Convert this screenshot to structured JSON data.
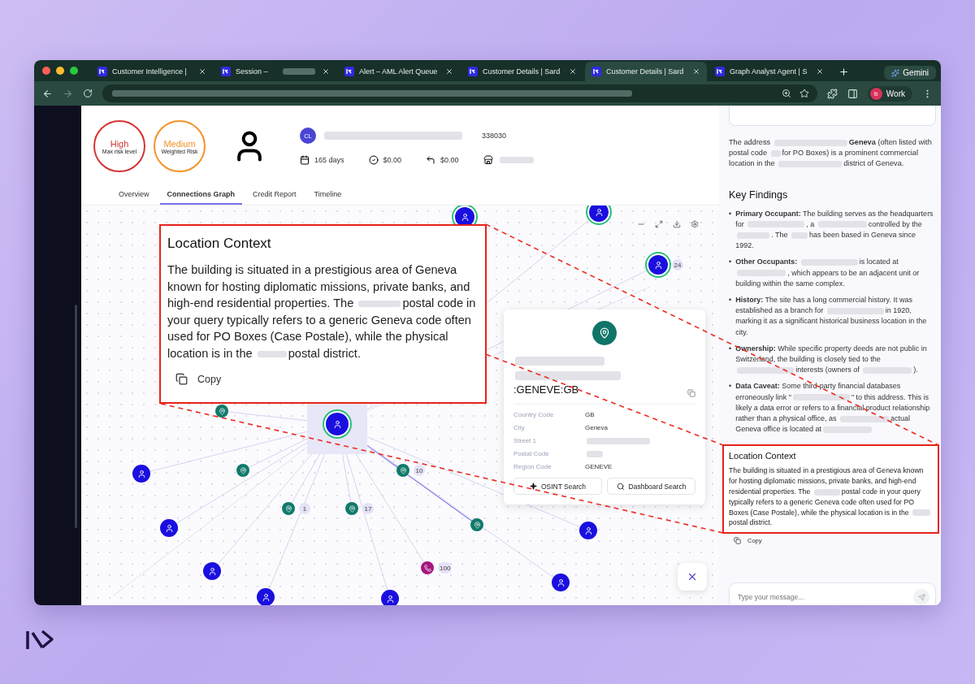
{
  "browser": {
    "tabs": [
      {
        "title": "Customer Intelligence | ",
        "selected": false
      },
      {
        "title": "Session – ",
        "selected": false
      },
      {
        "title": "Alert – AML Alert Queue",
        "selected": false
      },
      {
        "title": "Customer Details | Sard",
        "selected": false
      },
      {
        "title": "Customer Details | Sard",
        "selected": true
      },
      {
        "title": "Graph Analyst Agent | S",
        "selected": false
      }
    ],
    "assistant": "Gemini",
    "profile": {
      "initial": "b",
      "label": "Work"
    }
  },
  "header": {
    "risks": [
      {
        "level": "High",
        "caption": "Max risk level",
        "color": "#d63333"
      },
      {
        "level": "Medium",
        "caption": "Weighted Risk",
        "color": "#f5922a"
      }
    ],
    "initials": "CL",
    "customer_id": "338030",
    "stats": [
      {
        "kind": "calendar",
        "value": "165 days"
      },
      {
        "kind": "check",
        "value": "$0.00"
      },
      {
        "kind": "return",
        "value": "$0.00"
      },
      {
        "kind": "store"
      }
    ]
  },
  "page_tabs": [
    {
      "label": "Overview",
      "selected": false
    },
    {
      "label": "Connections Graph",
      "selected": true
    },
    {
      "label": "Credit Report",
      "selected": false
    },
    {
      "label": "Timeline",
      "selected": false
    }
  ],
  "graph": {
    "nodes": [
      {
        "kind": "person",
        "ring": true,
        "selected": false
      },
      {
        "kind": "person",
        "ring": true,
        "selected": false
      },
      {
        "kind": "person",
        "ring": true,
        "selected": false,
        "badge": "24"
      },
      {
        "kind": "person",
        "ring": true,
        "selected": true
      },
      {
        "kind": "location",
        "ring": false,
        "selected": false
      },
      {
        "kind": "location",
        "ring": false,
        "selected": false
      },
      {
        "kind": "location",
        "ring": false,
        "selected": false,
        "badge": "10"
      },
      {
        "kind": "location",
        "ring": false,
        "selected": false,
        "badge": "1"
      },
      {
        "kind": "location",
        "ring": false,
        "selected": false,
        "badge": "17"
      },
      {
        "kind": "location",
        "ring": false,
        "selected": false
      },
      {
        "kind": "phone",
        "ring": false,
        "selected": false,
        "badge": "100"
      },
      {
        "kind": "person",
        "ring": false,
        "selected": false
      },
      {
        "kind": "person",
        "ring": false,
        "selected": false
      },
      {
        "kind": "person",
        "ring": false,
        "selected": false
      },
      {
        "kind": "person",
        "ring": false,
        "selected": false
      },
      {
        "kind": "person",
        "ring": false,
        "selected": false
      },
      {
        "kind": "person",
        "ring": false,
        "selected": false
      },
      {
        "kind": "person",
        "ring": false,
        "selected": false
      }
    ]
  },
  "detail_card": {
    "title_end": ":GENEVE:GB",
    "fields": [
      {
        "label": "Country Code",
        "value": "GB"
      },
      {
        "label": "City",
        "value": "Geneva"
      },
      {
        "label": "Street 1"
      },
      {
        "label": "Postal Code"
      },
      {
        "label": "Region Code",
        "value": "GENEVE"
      }
    ],
    "buttons": [
      {
        "kind": "osint",
        "label": "OSINT Search"
      },
      {
        "kind": "search",
        "label": "Dashboard Search"
      }
    ]
  },
  "callout": {
    "title": "Location Context",
    "parts": [
      "The building is situated in a prestigious area of Geneva known for hosting diplomatic missions, private banks, and high-end residential properties. The ",
      "postal code in your query typically refers to a generic Geneva code often used for PO Boxes (Case Postale), while the physical location is in the ",
      "postal district."
    ],
    "copy": "Copy"
  },
  "chat": {
    "intro": [
      "The address ",
      "**Geneva** (often listed with postal code ",
      "for PO Boxes) is a prominent commercial location in the ",
      "district of Geneva."
    ],
    "heading": "Key Findings",
    "findings": [
      {
        "marker": "•",
        "parts": [
          "**Primary Occupant:** The building serves as the headquarters for ",
          ", a ",
          "controlled by the ",
          ". The ",
          "has been based in Geneva since 1992."
        ]
      },
      {
        "marker": "•",
        "parts": [
          "**Other Occupants:** ",
          "is located at ",
          ", which appears to be an adjacent unit or building within the same complex."
        ]
      },
      {
        "marker": "•",
        "parts": [
          "**History:** The site has a long commercial history. It was established as a branch for ",
          "in 1920, marking it as a significant historical business location in the city."
        ]
      },
      {
        "marker": "•",
        "parts": [
          "**Ownership:** While specific property deeds are not public in Switzerland, the building is closely tied to the ",
          "interests (owners of ",
          ")."
        ]
      },
      {
        "marker": "•",
        "parts": [
          "**Data Caveat:** Some third-party financial databases erroneously link \"",
          "\" to this address. This is likely a data error or refers to a financial product relationship rather than a physical office, as ",
          "actual Geneva office is located at"
        ],
        "ends_redacted": true
      }
    ],
    "context": {
      "title": "Location Context",
      "parts": [
        "The building is situated in a prestigious area of Geneva known for hosting diplomatic missions, private banks, and high-end residential properties. The ",
        "postal code in your query typically refers to a generic Geneva code often used for PO Boxes (Case Postale), while the physical location is in the ",
        "postal district."
      ]
    },
    "copy": "Copy",
    "input_placeholder": "Type your message..."
  }
}
